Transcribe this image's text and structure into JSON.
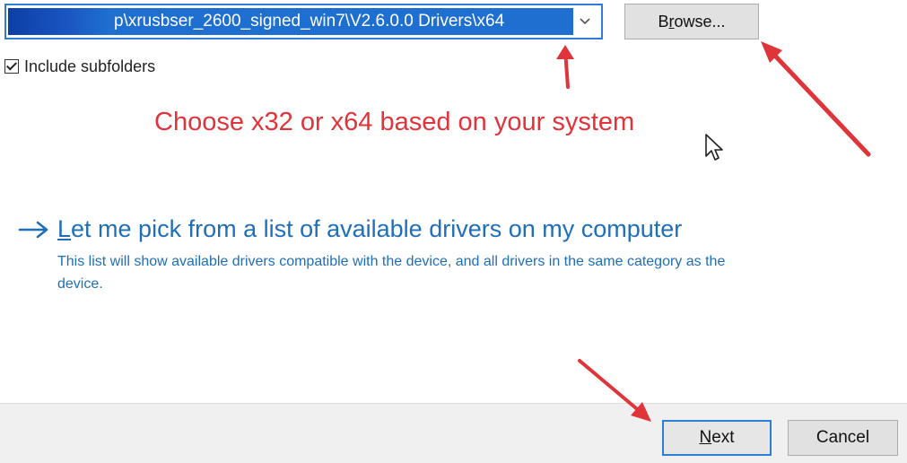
{
  "path_field": {
    "value": "p\\xrusbser_2600_signed_win7\\V2.6.0.0 Drivers\\x64",
    "dropdown_icon": "chevron-down-icon"
  },
  "browse_button": {
    "label_prefix": "B",
    "label_underlined": "r",
    "label_rest": "owse..."
  },
  "include_subfolders": {
    "label_underlined": "I",
    "label_rest": "nclude subfolders",
    "checked": true
  },
  "annotation": {
    "text": "Choose x32 or x64 based on your system",
    "color": "#e0343b"
  },
  "pick_from_list": {
    "icon": "arrow-right-icon",
    "label_underlined": "L",
    "label_rest": "et me pick from a list of available drivers on my computer",
    "description": "This list will show available drivers compatible with the device, and all drivers in the same category as the device."
  },
  "footer": {
    "next": {
      "label_underlined": "N",
      "label_rest": "ext"
    },
    "cancel": {
      "label": "Cancel"
    }
  },
  "colors": {
    "accent": "#2c7fd4",
    "link": "#1f6fb8",
    "annotation_arrow": "#e0343b"
  }
}
